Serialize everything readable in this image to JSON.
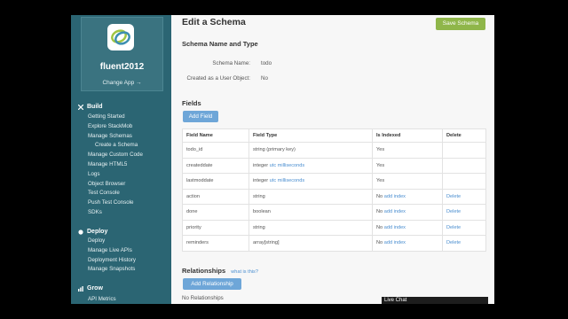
{
  "sidebar": {
    "app_name": "fluent2012",
    "change_app": "Change App →",
    "sections": [
      {
        "title": "Build",
        "icon": "tools-icon",
        "items": [
          {
            "label": "Getting Started",
            "sub": false
          },
          {
            "label": "Explore StackMob",
            "sub": false
          },
          {
            "label": "Manage Schemas",
            "sub": false
          },
          {
            "label": "Create a Schema",
            "sub": true
          },
          {
            "label": "Manage Custom Code",
            "sub": false
          },
          {
            "label": "Manage HTML5",
            "sub": false
          },
          {
            "label": "Logs",
            "sub": false
          },
          {
            "label": "Object Browser",
            "sub": false
          },
          {
            "label": "Test Console",
            "sub": false
          },
          {
            "label": "Push Test Console",
            "sub": false
          },
          {
            "label": "SDKs",
            "sub": false
          }
        ]
      },
      {
        "title": "Deploy",
        "icon": "deploy-icon",
        "items": [
          {
            "label": "Deploy",
            "sub": false
          },
          {
            "label": "Manage Live APIs",
            "sub": false
          },
          {
            "label": "Deployment History",
            "sub": false
          },
          {
            "label": "Manage Snapshots",
            "sub": false
          }
        ]
      },
      {
        "title": "Grow",
        "icon": "chart-icon",
        "items": [
          {
            "label": "API Metrics",
            "sub": false
          }
        ]
      }
    ]
  },
  "main": {
    "title": "Edit a Schema",
    "save_label": "Save Schema",
    "schema_section_title": "Schema Name and Type",
    "schema_name_label": "Schema Name:",
    "schema_name_value": "todo",
    "user_object_label": "Created as a User Object:",
    "user_object_value": "No",
    "fields_title": "Fields",
    "add_field_label": "Add Field",
    "columns": [
      "Field Name",
      "Field Type",
      "Is Indexed",
      "Delete"
    ],
    "rows": [
      {
        "name": "todo_id",
        "type": "string (primary key)",
        "type_link": "",
        "indexed": "Yes",
        "add_index": "",
        "delete": ""
      },
      {
        "name": "createddate",
        "type": "integer",
        "type_link": "utc milliseconds",
        "indexed": "Yes",
        "add_index": "",
        "delete": ""
      },
      {
        "name": "lastmoddate",
        "type": "integer",
        "type_link": "utc milliseconds",
        "indexed": "Yes",
        "add_index": "",
        "delete": ""
      },
      {
        "name": "action",
        "type": "string",
        "type_link": "",
        "indexed": "No",
        "add_index": "add index",
        "delete": "Delete"
      },
      {
        "name": "done",
        "type": "boolean",
        "type_link": "",
        "indexed": "No",
        "add_index": "add index",
        "delete": "Delete"
      },
      {
        "name": "priority",
        "type": "string",
        "type_link": "",
        "indexed": "No",
        "add_index": "add index",
        "delete": "Delete"
      },
      {
        "name": "reminders",
        "type": "array[string]",
        "type_link": "",
        "indexed": "No",
        "add_index": "add index",
        "delete": "Delete"
      }
    ],
    "relationships_title": "Relationships",
    "relationships_hint": "what is this?",
    "add_relationship_label": "Add Relationship",
    "no_relationships": "No Relationships"
  },
  "live_chat": "Live Chat"
}
